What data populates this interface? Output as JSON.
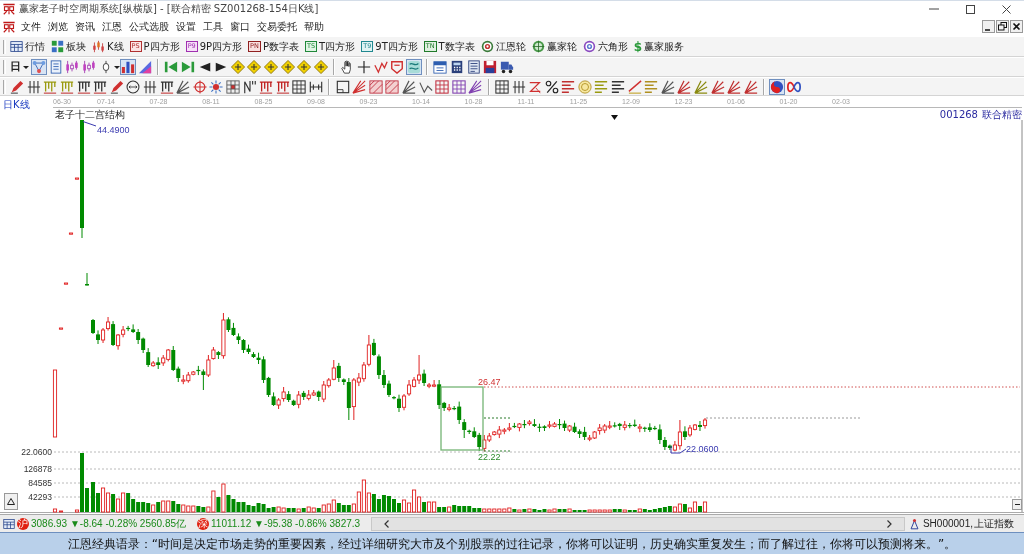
{
  "window": {
    "title": "赢家老子时空周期系统[纵横版] - [联合精密  SZ001268-154日K线]"
  },
  "menu": [
    "文件",
    "浏览",
    "资讯",
    "江恩",
    "公式选股",
    "设置",
    "工具",
    "窗口",
    "交易委托",
    "帮助"
  ],
  "toolbar_1": [
    {
      "label": "行情"
    },
    {
      "label": "板块"
    },
    {
      "label": "K线"
    },
    {
      "badge": "PS",
      "label": "P四方形"
    },
    {
      "badge": "P9",
      "label": "9P四方形"
    },
    {
      "badge": "PN",
      "label": "P数字表"
    },
    {
      "badge": "TS",
      "label": "T四方形"
    },
    {
      "badge": "T9",
      "label": "9T四方形"
    },
    {
      "badge": "TN",
      "label": "T数字表"
    },
    {
      "label": "江恩轮"
    },
    {
      "label": "赢家轮"
    },
    {
      "label": "六角形"
    },
    {
      "icon_char": "$",
      "label": "赢家服务"
    }
  ],
  "toolbar_2": {
    "period": "日",
    "groups": [
      [
        {
          "pressed": true
        },
        {
          "pressed": false
        },
        {
          "pressed": false
        },
        {
          "pressed": false
        },
        {
          "pressed": false
        },
        {
          "pressed": true
        },
        {
          "pressed": false
        }
      ],
      [
        {
          "pressed": false
        },
        {
          "pressed": false
        },
        {
          "pressed": false
        },
        {
          "pressed": false
        },
        {
          "pressed": false
        },
        {
          "pressed": false
        },
        {
          "pressed": false
        },
        {
          "pressed": false
        },
        {
          "pressed": false
        },
        {
          "pressed": false
        }
      ],
      [
        {
          "pressed": false
        },
        {
          "pressed": false
        },
        {
          "pressed": false
        },
        {
          "pressed": false
        },
        {
          "pressed": true
        }
      ],
      [
        {
          "pressed": false
        },
        {
          "pressed": false
        },
        {
          "pressed": false
        },
        {
          "pressed": false
        },
        {
          "pressed": false
        }
      ]
    ]
  },
  "toolbar_3": {
    "groups": [
      [
        {
          "pressed": false
        },
        {
          "pressed": false
        },
        {
          "pressed": false
        },
        {
          "pressed": false
        },
        {
          "pressed": false
        },
        {
          "pressed": false
        },
        {
          "pressed": false
        },
        {
          "pressed": false
        },
        {
          "pressed": false
        },
        {
          "pressed": false
        },
        {
          "pressed": false
        },
        {
          "pressed": false
        },
        {
          "pressed": false
        },
        {
          "pressed": false
        },
        {
          "pressed": false
        },
        {
          "pressed": false
        },
        {
          "pressed": false
        },
        {
          "pressed": false
        },
        {
          "pressed": false
        }
      ],
      [
        {
          "pressed": false
        },
        {
          "pressed": false
        },
        {
          "pressed": false
        },
        {
          "pressed": false
        },
        {
          "pressed": false
        },
        {
          "pressed": false
        },
        {
          "pressed": false
        },
        {
          "pressed": false
        },
        {
          "pressed": false
        }
      ],
      [
        {
          "pressed": false
        },
        {
          "pressed": false
        },
        {
          "pressed": false
        },
        {
          "pressed": false
        },
        {
          "pressed": false
        },
        {
          "pressed": false
        },
        {
          "pressed": false
        },
        {
          "pressed": false
        },
        {
          "pressed": false
        },
        {
          "pressed": false
        },
        {
          "pressed": false
        },
        {
          "pressed": false
        },
        {
          "pressed": false
        },
        {
          "pressed": false
        },
        {
          "pressed": false
        },
        {
          "pressed": false
        }
      ],
      [
        {
          "pressed": true
        },
        {
          "pressed": false
        }
      ]
    ]
  },
  "chart": {
    "period": "日K线",
    "dates": [
      "06-30",
      "07-14",
      "07-28",
      "08-11",
      "08-25",
      "09-08",
      "09-23",
      "10-14",
      "10-28",
      "11-11",
      "11-25",
      "12-09",
      "12-23",
      "01-06",
      "01-20",
      "02-03"
    ],
    "indicator": "老子十二宫结构",
    "stock_code": "001268",
    "stock_name": "联合精密",
    "price_axis_label": "22.0600",
    "annotations": [
      {
        "kind": "peak",
        "text": "44.4900"
      },
      {
        "kind": "box_high",
        "text": "26.47"
      },
      {
        "kind": "box_low",
        "text": "22.22"
      },
      {
        "kind": "trough",
        "text": "22.0600"
      }
    ],
    "volume_ticks": [
      "126878",
      "84585",
      "42293"
    ]
  },
  "status_bar": {
    "indices": [
      {
        "badge": "沪",
        "quote": "3086.93 ▼-8.64 -0.28% 2560.85亿"
      },
      {
        "badge": "深",
        "quote": "11011.12 ▼-95.38 -0.86% 3827.3"
      }
    ],
    "index_code": "SH000001,",
    "index_name": "上证指数"
  },
  "quote": "江恩经典语录：“时间是决定市场走势的重要因素，经过详细研究大市及个别股票的过往记录，你将可以证明，历史确实重复发生；而了解过往，你将可以预测将来。”。"
}
